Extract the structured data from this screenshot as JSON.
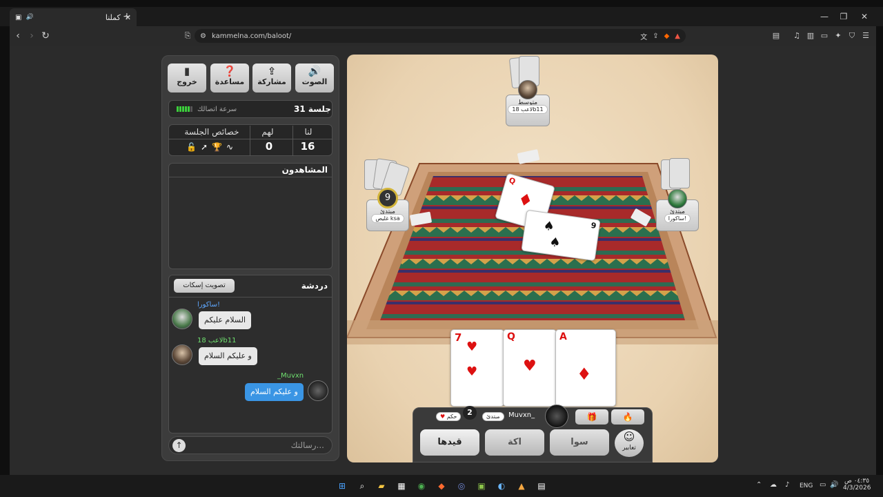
{
  "browser": {
    "tab_title": "كملنا",
    "url": "kammelna.com/baloot/"
  },
  "toolbar_buttons": [
    {
      "label": "الصوت",
      "icon": "speaker-icon"
    },
    {
      "label": "مشاركة",
      "icon": "share-icon"
    },
    {
      "label": "مساعدة",
      "icon": "help-icon"
    },
    {
      "label": "خروج",
      "icon": "exit-door-icon"
    }
  ],
  "session": {
    "label": "جلسة 31",
    "connection_label": "سرعة اتصالك",
    "connection_level": 5
  },
  "score": {
    "us_label": "لنا",
    "them_label": "لهم",
    "props_label": "خصائص الجلسة",
    "us_value": "16",
    "them_value": "0"
  },
  "watchers": {
    "title": "المشاهدون"
  },
  "chat": {
    "title": "دردشة",
    "mute_vote_label": "تصويت إسكات",
    "messages": [
      {
        "user": "ساكورا!",
        "text": "السلام عليكم",
        "user_color": "#5fa8ff"
      },
      {
        "user": "لاعب 18b11",
        "text": "و عليكم السلام",
        "user_color": "#6fe06f"
      },
      {
        "user": "_Muvxn",
        "text": "و عليكم السلام",
        "user_color": "#6fe06f"
      }
    ],
    "input_placeholder": "رسالتك..."
  },
  "players": {
    "top": {
      "level": "متوسط",
      "name": "لاعب 18b11"
    },
    "left": {
      "level": "مبتدئ",
      "name": "غليص ksa",
      "timer": "9"
    },
    "right": {
      "level": "مبتدئ",
      "name": "ساكورا!"
    },
    "me": {
      "name": "Muvxn_",
      "level": "مبتدئ",
      "mode": "حكم",
      "round": "2"
    }
  },
  "table_cards": [
    {
      "rank": "Q",
      "suit": "♦"
    },
    {
      "rank": "9",
      "suit": "♠"
    }
  ],
  "hand_cards": [
    {
      "rank": "7",
      "suit": "♥"
    },
    {
      "rank": "Q",
      "suit": "♥"
    },
    {
      "rank": "A",
      "suit": "♦"
    }
  ],
  "actions": [
    {
      "label": "قيدها"
    },
    {
      "label": "اكة"
    },
    {
      "label": "سوا"
    }
  ],
  "emotes_label": "تعابير",
  "taskbar": {
    "lang": "ENG",
    "time": "٠٤:٣٥ ص",
    "date": "4/3/2026"
  }
}
